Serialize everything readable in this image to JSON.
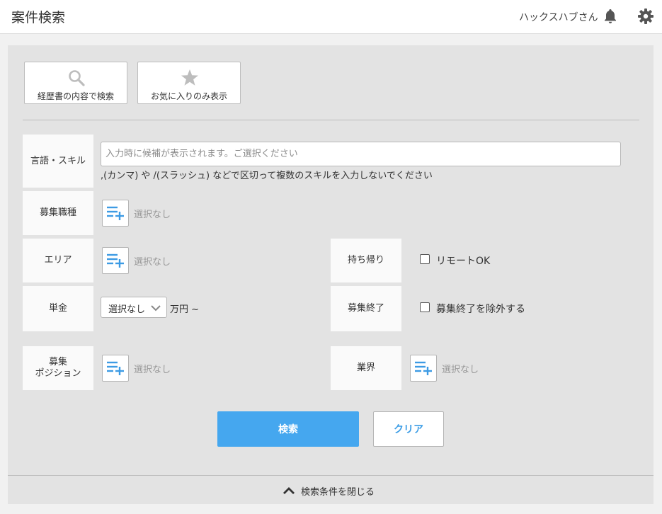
{
  "header": {
    "title": "案件検索",
    "user_name": "ハックスハブさん",
    "icons": [
      "bell-icon",
      "gear-icon"
    ]
  },
  "top_buttons": {
    "resume_search": "経歴書の内容で検索",
    "favorites_only": "お気に入りのみ表示"
  },
  "fields": {
    "skill": {
      "label": "言語・スキル",
      "placeholder": "入力時に候補が表示されます。ご選択ください",
      "value": "",
      "note": ",(カンマ) や /(スラッシュ) などで区切って複数のスキルを入力しないでください"
    },
    "job_type": {
      "label": "募集職種",
      "value": "選択なし"
    },
    "area": {
      "label": "エリア",
      "value": "選択なし"
    },
    "remote": {
      "label": "持ち帰り",
      "option": "リモートOK",
      "checked": false
    },
    "price": {
      "label": "単金",
      "selected": "選択なし",
      "unit": "万円 ~"
    },
    "ended": {
      "label": "募集終了",
      "option": "募集終了を除外する",
      "checked": false
    },
    "position": {
      "label_line1": "募集",
      "label_line2": "ポジション",
      "value": "選択なし"
    },
    "industry": {
      "label": "業界",
      "value": "選択なし"
    }
  },
  "actions": {
    "search": "検索",
    "clear": "クリア",
    "close_conditions": "検索条件を閉じる"
  },
  "colors": {
    "accent": "#45a7ef",
    "link": "#3c9de6",
    "panel_bg": "#e3e3e3",
    "label_bg": "#fafafa"
  }
}
